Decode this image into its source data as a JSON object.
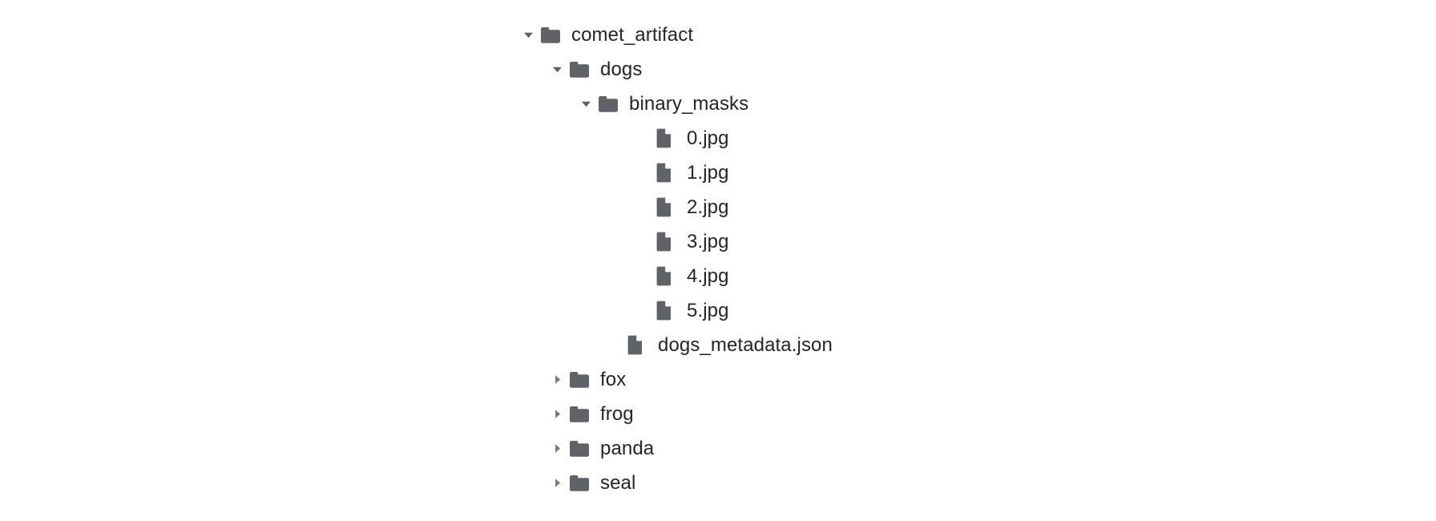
{
  "view": {
    "name": "file-tree",
    "background_color": "#ffffff",
    "text_color": "#232527",
    "icon_color": "#5f6368",
    "twisty_color": "#5f6368",
    "twisty_collapsed_color": "#797c80"
  },
  "tree": {
    "nodes": [
      {
        "label": "comet_artifact",
        "type": "folder",
        "depth": 0,
        "state": "expanded",
        "twisty_icon": "caret-down-icon",
        "icon": "folder-icon"
      },
      {
        "label": "dogs",
        "type": "folder",
        "depth": 1,
        "state": "expanded",
        "twisty_icon": "caret-down-icon",
        "icon": "folder-icon"
      },
      {
        "label": "binary_masks",
        "type": "folder",
        "depth": 2,
        "state": "expanded",
        "twisty_icon": "caret-down-icon",
        "icon": "folder-icon"
      },
      {
        "label": "0.jpg",
        "type": "file",
        "depth": 4,
        "state": "leaf",
        "twisty_icon": "",
        "icon": "file-icon"
      },
      {
        "label": "1.jpg",
        "type": "file",
        "depth": 4,
        "state": "leaf",
        "twisty_icon": "",
        "icon": "file-icon"
      },
      {
        "label": "2.jpg",
        "type": "file",
        "depth": 4,
        "state": "leaf",
        "twisty_icon": "",
        "icon": "file-icon"
      },
      {
        "label": "3.jpg",
        "type": "file",
        "depth": 4,
        "state": "leaf",
        "twisty_icon": "",
        "icon": "file-icon"
      },
      {
        "label": "4.jpg",
        "type": "file",
        "depth": 4,
        "state": "leaf",
        "twisty_icon": "",
        "icon": "file-icon"
      },
      {
        "label": "5.jpg",
        "type": "file",
        "depth": 4,
        "state": "leaf",
        "twisty_icon": "",
        "icon": "file-icon"
      },
      {
        "label": "dogs_metadata.json",
        "type": "file",
        "depth": 3,
        "state": "leaf",
        "twisty_icon": "",
        "icon": "file-icon"
      },
      {
        "label": "fox",
        "type": "folder",
        "depth": 1,
        "state": "collapsed",
        "twisty_icon": "caret-right-icon",
        "icon": "folder-icon"
      },
      {
        "label": "frog",
        "type": "folder",
        "depth": 1,
        "state": "collapsed",
        "twisty_icon": "caret-right-icon",
        "icon": "folder-icon"
      },
      {
        "label": "panda",
        "type": "folder",
        "depth": 1,
        "state": "collapsed",
        "twisty_icon": "caret-right-icon",
        "icon": "folder-icon"
      },
      {
        "label": "seal",
        "type": "folder",
        "depth": 1,
        "state": "collapsed",
        "twisty_icon": "caret-right-icon",
        "icon": "folder-icon"
      }
    ]
  }
}
